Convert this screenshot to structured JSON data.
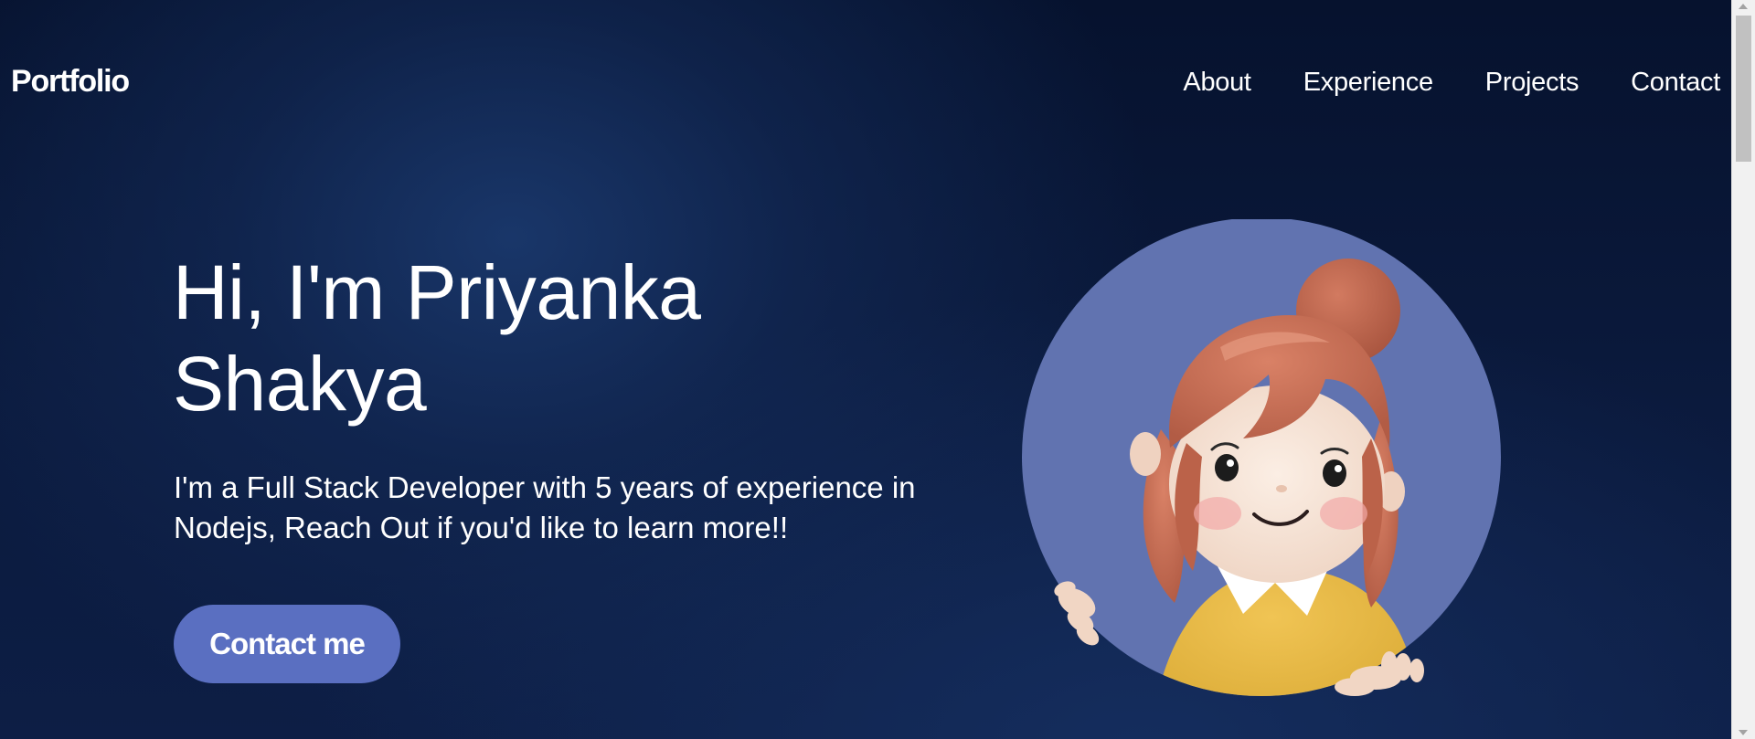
{
  "nav": {
    "logo": "Portfolio",
    "links": [
      "About",
      "Experience",
      "Projects",
      "Contact"
    ]
  },
  "hero": {
    "title": "Hi, I'm Priyanka Shakya",
    "description": "I'm a Full Stack Developer with 5 years of experience in Nodejs, Reach Out if you'd like to learn more!!",
    "cta_label": "Contact me"
  },
  "avatar": {
    "icon": "cartoon-girl-avatar"
  },
  "colors": {
    "background": "#0b1a3d",
    "accent": "#5a6fc1",
    "avatar_circle": "#6173b0",
    "hair": "#c26a52",
    "shirt": "#e3b53c"
  }
}
